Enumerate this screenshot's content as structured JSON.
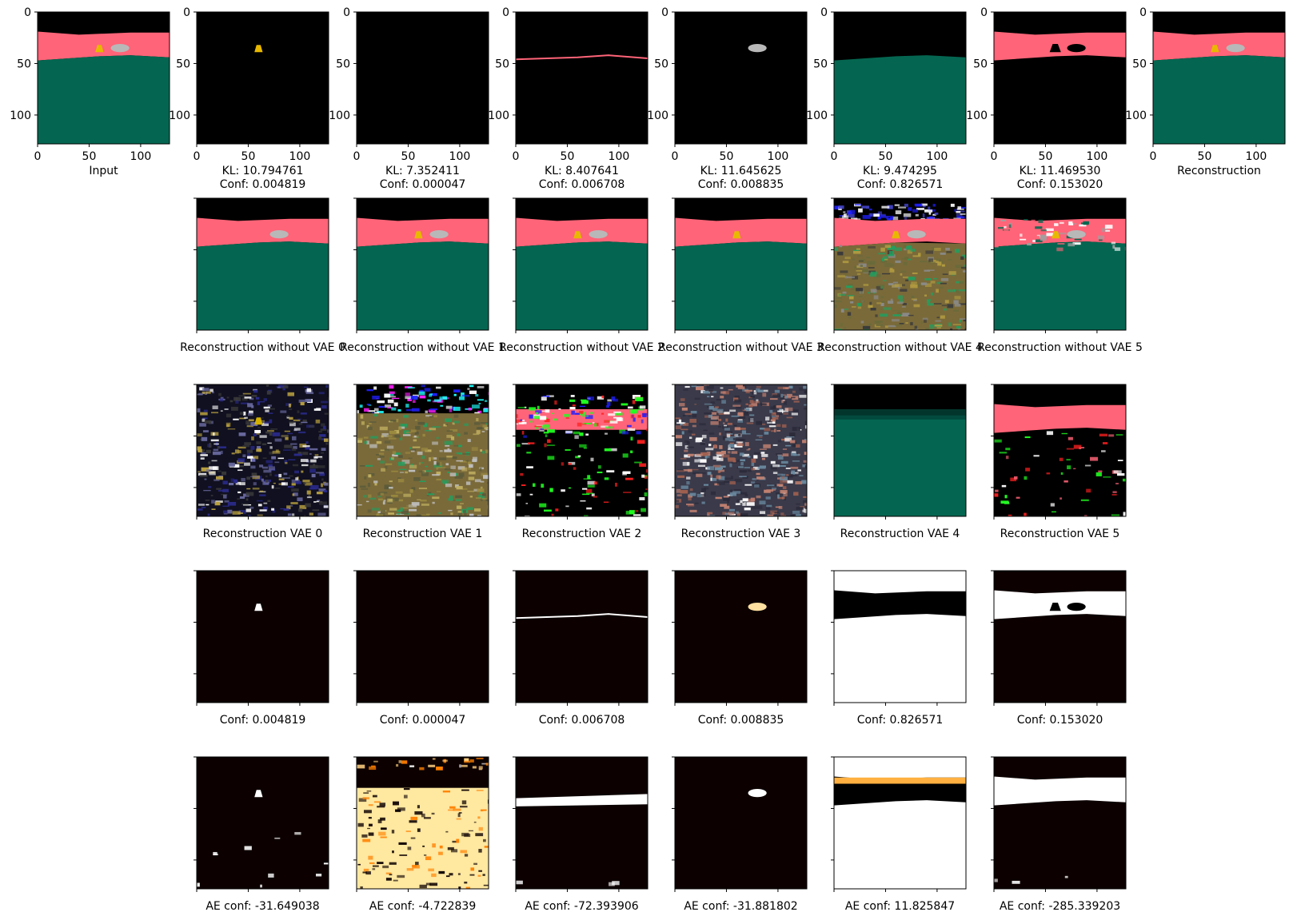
{
  "figure": {
    "rows": [
      {
        "row": "kl",
        "panels": [
          {
            "caption": "Input",
            "kind": "scene"
          },
          {
            "caption": "KL: 10.794761\nConf: 0.004819",
            "kind": "mask_color",
            "object": "cone"
          },
          {
            "caption": "KL: 7.352411\nConf: 0.000047",
            "kind": "mask_color",
            "object": "none"
          },
          {
            "caption": "KL: 8.407641\nConf: 0.006708",
            "kind": "mask_color",
            "object": "horizon"
          },
          {
            "caption": "KL: 11.645625\nConf: 0.008835",
            "kind": "mask_color",
            "object": "car"
          },
          {
            "caption": "KL: 9.474295\nConf: 0.826571",
            "kind": "mask_color",
            "object": "ground"
          },
          {
            "caption": "KL: 11.469530\nConf: 0.153020",
            "kind": "mask_color",
            "object": "wall"
          },
          {
            "caption": "Reconstruction",
            "kind": "scene"
          }
        ]
      },
      {
        "row": "without",
        "panels": [
          {
            "caption": "Reconstruction without VAE 0",
            "kind": "scene_no_cone"
          },
          {
            "caption": "Reconstruction without VAE 1",
            "kind": "scene"
          },
          {
            "caption": "Reconstruction without VAE 2",
            "kind": "scene"
          },
          {
            "caption": "Reconstruction without VAE 3",
            "kind": "scene_no_car"
          },
          {
            "caption": "Reconstruction without VAE 4",
            "kind": "noisy_scene"
          },
          {
            "caption": "Reconstruction without VAE 5",
            "kind": "scene_noisy_top"
          }
        ]
      },
      {
        "row": "vae",
        "panels": [
          {
            "caption": "Reconstruction VAE 0",
            "kind": "noise_blue_gold"
          },
          {
            "caption": "Reconstruction VAE 1",
            "kind": "noise_olive"
          },
          {
            "caption": "Reconstruction VAE 2",
            "kind": "noise_dark_pink"
          },
          {
            "caption": "Reconstruction VAE 3",
            "kind": "noise_brown"
          },
          {
            "caption": "Reconstruction VAE 4",
            "kind": "blur_green"
          },
          {
            "caption": "Reconstruction VAE 5",
            "kind": "dark_pink_band"
          }
        ]
      },
      {
        "row": "conf",
        "panels": [
          {
            "caption": "Conf: 0.004819",
            "kind": "bw_cone"
          },
          {
            "caption": "Conf: 0.000047",
            "kind": "bw_none"
          },
          {
            "caption": "Conf: 0.006708",
            "kind": "bw_horizon"
          },
          {
            "caption": "Conf: 0.008835",
            "kind": "bw_car"
          },
          {
            "caption": "Conf: 0.826571",
            "kind": "bw_ground"
          },
          {
            "caption": "Conf: 0.153020",
            "kind": "bw_wall"
          }
        ]
      },
      {
        "row": "ae",
        "panels": [
          {
            "caption": "AE conf: -31.649038",
            "kind": "ae_cone"
          },
          {
            "caption": "AE conf: -4.722839",
            "kind": "ae_blotchy"
          },
          {
            "caption": "AE conf: -72.393906",
            "kind": "ae_horizon"
          },
          {
            "caption": "AE conf: -31.881802",
            "kind": "ae_car"
          },
          {
            "caption": "AE conf: 11.825847",
            "kind": "ae_ground"
          },
          {
            "caption": "AE conf: -285.339203",
            "kind": "ae_wall"
          }
        ]
      }
    ],
    "axis_ticks": {
      "x": [
        "0",
        "50",
        "100"
      ],
      "y": [
        "0",
        "50",
        "100"
      ]
    },
    "colors": {
      "sky": "#000000",
      "wall": "#ff6478",
      "ground": "#046650",
      "cone": "#e8b800",
      "car": "#b8b8b8",
      "mask_bg": "#0c0000",
      "mask_fg": "#ffffff"
    }
  },
  "chart_data": {
    "type": "heatmap",
    "description_values": {
      "kl": [
        10.794761,
        7.352411,
        8.407641,
        11.645625,
        9.474295,
        11.46953
      ],
      "conf": [
        0.004819,
        4.7e-05,
        0.006708,
        0.008835,
        0.826571,
        0.15302
      ],
      "ae_conf": [
        -31.649038,
        -4.722839,
        -72.393906,
        -31.881802,
        11.825847,
        -285.339203
      ]
    },
    "image_size": [
      128,
      128
    ],
    "xlim": [
      0,
      128
    ],
    "ylim": [
      128,
      0
    ],
    "xticks": [
      0,
      50,
      100
    ],
    "yticks": [
      0,
      50,
      100
    ]
  }
}
